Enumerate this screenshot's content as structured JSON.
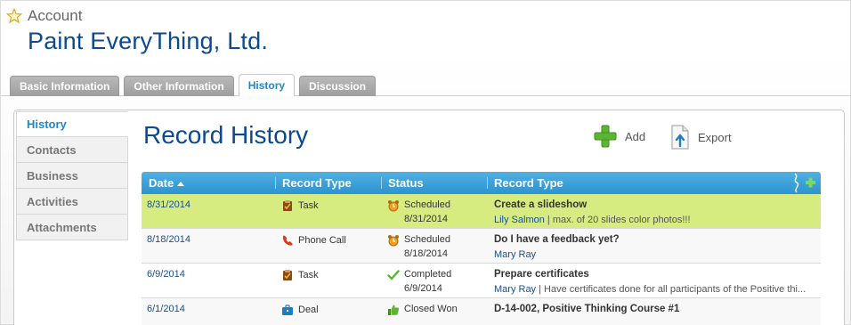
{
  "header": {
    "account_label": "Account",
    "company_name": "Paint EveryThing, Ltd."
  },
  "tabs": [
    {
      "label": "Basic Information",
      "active": false
    },
    {
      "label": "Other Information",
      "active": false
    },
    {
      "label": "History",
      "active": true
    },
    {
      "label": "Discussion",
      "active": false
    }
  ],
  "sidebar": {
    "items": [
      {
        "label": "History",
        "active": true
      },
      {
        "label": "Contacts",
        "active": false
      },
      {
        "label": "Business",
        "active": false
      },
      {
        "label": "Activities",
        "active": false
      },
      {
        "label": "Attachments",
        "active": false
      }
    ]
  },
  "main": {
    "title": "Record History",
    "actions": {
      "add_label": "Add",
      "export_label": "Export"
    }
  },
  "grid": {
    "columns": [
      {
        "label": "Date",
        "sorted": "asc"
      },
      {
        "label": "Record Type"
      },
      {
        "label": "Status"
      },
      {
        "label": "Record Type"
      }
    ],
    "rows": [
      {
        "date": "8/31/2014",
        "type": "Task",
        "type_icon": "task-icon",
        "status": "Scheduled",
        "status_date": "8/31/2014",
        "status_icon": "alarm-clock-icon",
        "title": "Create a slideshow",
        "person": "Lily Salmon",
        "note": " | max. of 20 slides color photos!!!",
        "selected": true
      },
      {
        "date": "8/18/2014",
        "type": "Phone Call",
        "type_icon": "phone-icon",
        "status": "Scheduled",
        "status_date": "8/18/2014",
        "status_icon": "alarm-clock-icon",
        "title": "Do I have a feedback yet?",
        "person": "Mary Ray",
        "note": ""
      },
      {
        "date": "6/9/2014",
        "type": "Task",
        "type_icon": "task-icon",
        "status": "Completed",
        "status_date": "6/9/2014",
        "status_icon": "checkmark-icon",
        "title": "Prepare certificates",
        "person": "Mary Ray",
        "note": " | Have certificates done for all participants of the Positive thi..."
      },
      {
        "date": "6/1/2014",
        "type": "Deal",
        "type_icon": "briefcase-icon",
        "status": "Closed Won",
        "status_date": "",
        "status_icon": "thumbs-up-icon",
        "title": "D-14-002, Positive Thinking Course #1",
        "person": "",
        "note": ""
      }
    ]
  },
  "colors": {
    "title_blue": "#0b4a8e",
    "accent_blue": "#1e88c8",
    "grid_header": "#2d93cf",
    "selected_row": "#d6ec80",
    "add_green": "#5cb531"
  }
}
